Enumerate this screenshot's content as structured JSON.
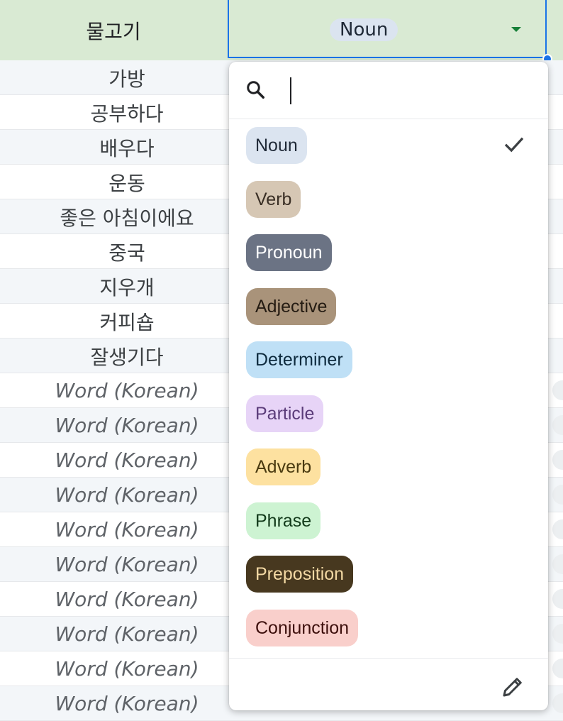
{
  "header": {
    "word": "물고기",
    "selected_value": "Noun"
  },
  "rows": [
    {
      "word": "가방",
      "placeholder": false
    },
    {
      "word": "공부하다",
      "placeholder": false
    },
    {
      "word": "배우다",
      "placeholder": false
    },
    {
      "word": "운동",
      "placeholder": false
    },
    {
      "word": "좋은 아침이에요",
      "placeholder": false
    },
    {
      "word": "중국",
      "placeholder": false
    },
    {
      "word": "지우개",
      "placeholder": false
    },
    {
      "word": "커피숍",
      "placeholder": false
    },
    {
      "word": "잘생기다",
      "placeholder": false
    },
    {
      "word": "Word (Korean)",
      "placeholder": true
    },
    {
      "word": "Word (Korean)",
      "placeholder": true
    },
    {
      "word": "Word (Korean)",
      "placeholder": true
    },
    {
      "word": "Word (Korean)",
      "placeholder": true
    },
    {
      "word": "Word (Korean)",
      "placeholder": true
    },
    {
      "word": "Word (Korean)",
      "placeholder": true
    },
    {
      "word": "Word (Korean)",
      "placeholder": true
    },
    {
      "word": "Word (Korean)",
      "placeholder": true
    },
    {
      "word": "Word (Korean)",
      "placeholder": true
    },
    {
      "word": "Word (Korean)",
      "placeholder": true
    }
  ],
  "dropdown": {
    "search": {
      "value": "",
      "icon": "search-icon"
    },
    "options": [
      {
        "label": "Noun",
        "bg": "#dbe4f0",
        "fg": "#1f2937",
        "selected": true
      },
      {
        "label": "Verb",
        "bg": "#d6c7b4",
        "fg": "#3a2f25",
        "selected": false
      },
      {
        "label": "Pronoun",
        "bg": "#6b7384",
        "fg": "#ffffff",
        "selected": false
      },
      {
        "label": "Adjective",
        "bg": "#a9937a",
        "fg": "#241b12",
        "selected": false
      },
      {
        "label": "Determiner",
        "bg": "#bfe0f6",
        "fg": "#0d2a3d",
        "selected": false
      },
      {
        "label": "Particle",
        "bg": "#e7d4f7",
        "fg": "#5b3c7a",
        "selected": false
      },
      {
        "label": "Adverb",
        "bg": "#fde1a0",
        "fg": "#4a3a10",
        "selected": false
      },
      {
        "label": "Phrase",
        "bg": "#cdf3d2",
        "fg": "#123a1a",
        "selected": false
      },
      {
        "label": "Preposition",
        "bg": "#47381f",
        "fg": "#f3d9a4",
        "selected": false
      },
      {
        "label": "Conjunction",
        "bg": "#f9cfcb",
        "fg": "#3d0f0c",
        "selected": false
      }
    ],
    "footer_icon": "pencil-icon",
    "check_icon": "check-icon"
  }
}
